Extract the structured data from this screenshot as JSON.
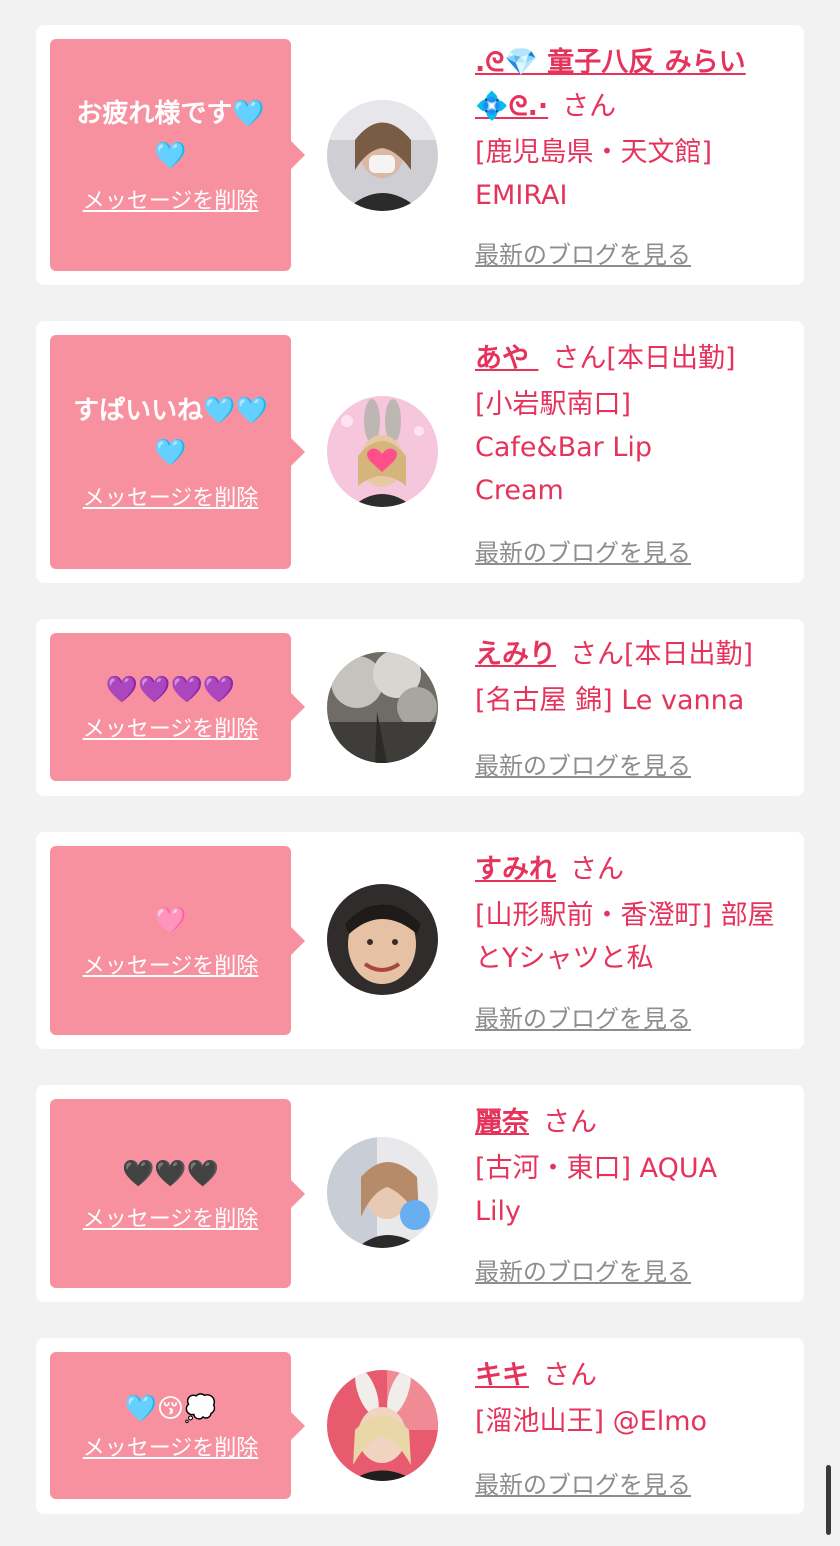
{
  "colors": {
    "accent": "#e5335c",
    "bubble": "#f7909f",
    "muted": "#8d8d8d"
  },
  "delete_label": "メッセージを削除",
  "blog_label": "最新のブログを見る",
  "san_label": "さん",
  "items": [
    {
      "message": "お疲れ様です🩵🩵",
      "name": ".ᘓ💎 童子八反 みらい💠ᘓ.·",
      "status": "",
      "shop": "[鹿児島県・天文館] EMIRAI",
      "avatar_icon": "profile-photo"
    },
    {
      "message": "すぱいいね🩵🩵🩵",
      "name": "あや ",
      "status": "[本日出勤]",
      "shop": "[小岩駅南口] Cafe&Bar Lip Cream",
      "avatar_icon": "profile-photo"
    },
    {
      "message": "💜💜💜💜",
      "name": "えみり",
      "status": "[本日出勤]",
      "shop": "[名古屋 錦] Le vanna",
      "avatar_icon": "profile-photo"
    },
    {
      "message": "🩷",
      "name": "すみれ",
      "status": "",
      "shop": "[山形駅前・香澄町] 部屋とYシャツと私",
      "avatar_icon": "profile-photo"
    },
    {
      "message": "🖤🖤🖤",
      "name": "麗奈",
      "status": "",
      "shop": "[古河・東口] AQUA Lily",
      "avatar_icon": "profile-photo"
    },
    {
      "message": "🩵😚💭",
      "name": "キキ",
      "status": "",
      "shop": "[溜池山王] @Elmo",
      "avatar_icon": "profile-photo"
    }
  ]
}
